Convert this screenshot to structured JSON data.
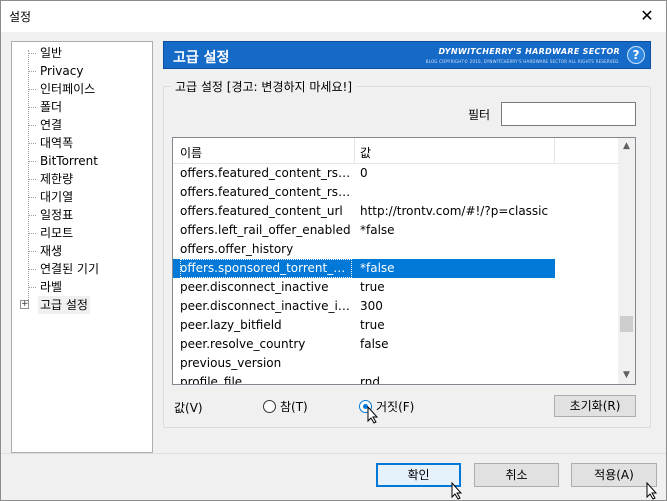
{
  "window": {
    "title": "설정",
    "close_glyph": "✕"
  },
  "tree": {
    "items": [
      {
        "label": "일반"
      },
      {
        "label": "Privacy"
      },
      {
        "label": "인터페이스"
      },
      {
        "label": "폴더"
      },
      {
        "label": "연결"
      },
      {
        "label": "대역폭"
      },
      {
        "label": "BitTorrent"
      },
      {
        "label": "제한량"
      },
      {
        "label": "대기열"
      },
      {
        "label": "일정표"
      },
      {
        "label": "리모트"
      },
      {
        "label": "재생"
      },
      {
        "label": "연결된 기기"
      },
      {
        "label": "라벨"
      },
      {
        "label": "고급 설정",
        "expander": "+",
        "selected": true
      }
    ]
  },
  "banner": {
    "title": "고급 설정",
    "brand": "DYNWITCHERRY'S HARDWARE SECTOR",
    "brand_sub": "BLOG COPYRIGHT© 2010, DYNWITCHERRY'S HARDWARE SECTOR ALL RIGHTS RESERVED.",
    "help": "?"
  },
  "group": {
    "legend": "고급 설정 [경고: 변경하지 마세요!]"
  },
  "filter": {
    "label": "필터",
    "value": ""
  },
  "grid": {
    "headers": {
      "name": "이름",
      "value": "값"
    },
    "rows": [
      {
        "name": "offers.featured_content_rss_up...",
        "value": "0"
      },
      {
        "name": "offers.featured_content_rss_url",
        "value": ""
      },
      {
        "name": "offers.featured_content_url",
        "value": "http://trontv.com/#!/?p=classic"
      },
      {
        "name": "offers.left_rail_offer_enabled",
        "value": "*false"
      },
      {
        "name": "offers.offer_history",
        "value": ""
      },
      {
        "name": "offers.sponsored_torrent_offer...",
        "value": "*false",
        "selected": true
      },
      {
        "name": "peer.disconnect_inactive",
        "value": "true"
      },
      {
        "name": "peer.disconnect_inactive_inter...",
        "value": "300"
      },
      {
        "name": "peer.lazy_bitfield",
        "value": "true"
      },
      {
        "name": "peer.resolve_country",
        "value": "false"
      },
      {
        "name": "previous_version",
        "value": ""
      },
      {
        "name": "profile_file",
        "value": "rnd"
      }
    ]
  },
  "value_section": {
    "label": "값(V)",
    "true_label": "참(T)",
    "false_label": "거짓(F)",
    "selected": "false",
    "reset_label": "초기화(R)"
  },
  "footer": {
    "ok": "확인",
    "cancel": "취소",
    "apply": "적용(A)"
  },
  "colors": {
    "accent": "#0078d7",
    "banner": "#1569c7"
  }
}
